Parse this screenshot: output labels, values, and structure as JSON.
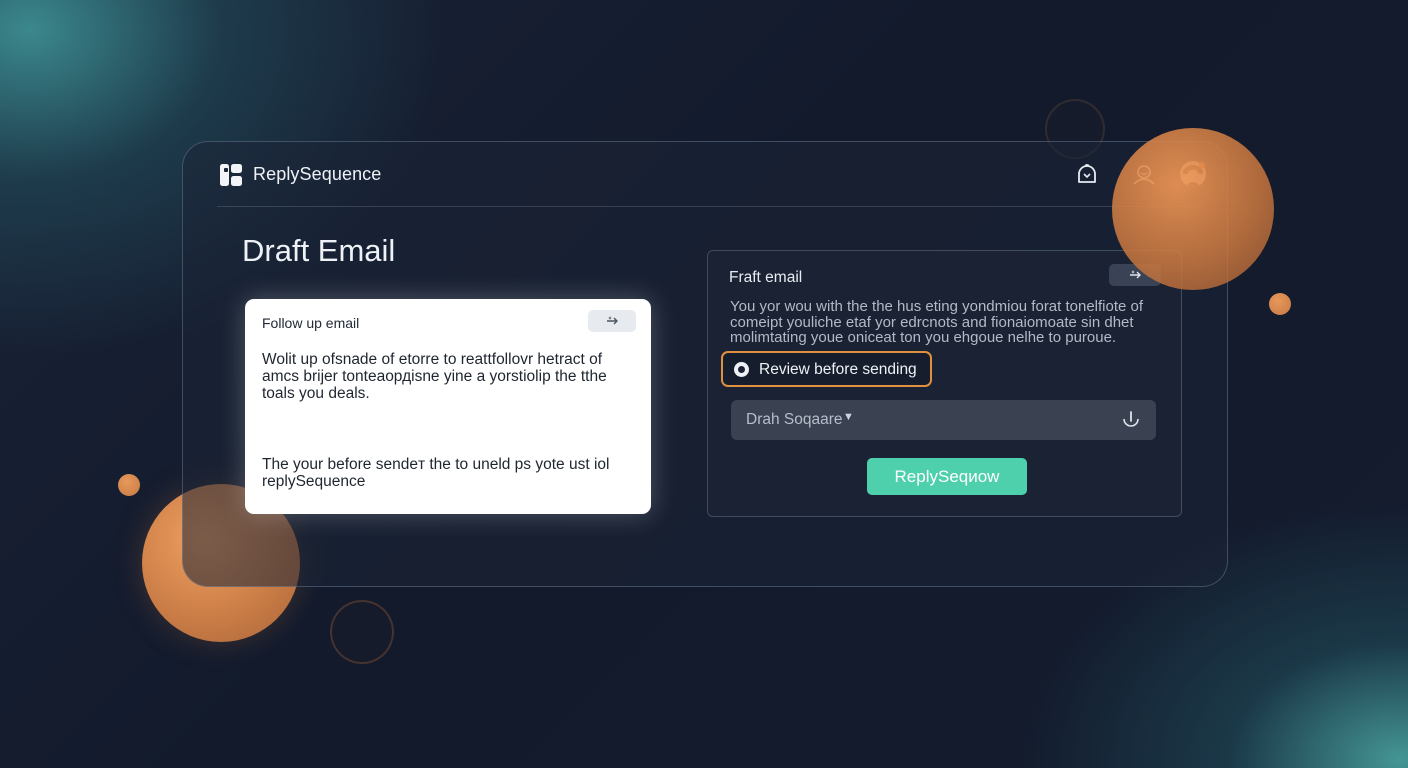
{
  "app": {
    "name": "ReplySequence"
  },
  "page": {
    "title": "Draft Email"
  },
  "follow_up_card": {
    "title": "Follow up email",
    "body_primary": "Wolit up ofsnade of etorre to reattfollovr hetract of amcs brijer tonteaордisne yine a yorstiolip the tthe toals you deals.",
    "body_secondary": "The your before sendeт the to uneld ps yote ust iol replySequence"
  },
  "draft_panel": {
    "title": "Fraft email",
    "description": "You yor wou with the the hus eting yondmiou forat tonelfiote of comeipt youliche etaf yor edrcnots and fionaiomoate sin dhet molimtating youe oniceat ton you ehgoue nelhe to puroue.",
    "review_toggle_label": "Review before sending",
    "review_checked": true,
    "select_value": "Drah Soqaare",
    "cta_label": "ReplySeqиow"
  },
  "icons": {
    "logo": "logo-icon",
    "notifications": "bell-icon",
    "profile": "user-icon",
    "avatar": "avatar",
    "magic": "sparkle-icon",
    "select_caret": "chevron-down-icon",
    "mic": "microphone-icon"
  },
  "colors": {
    "accent": "#4fd0ad",
    "highlight_border": "#e0913f",
    "orb": "#d4884e",
    "background": "#141c2e"
  }
}
